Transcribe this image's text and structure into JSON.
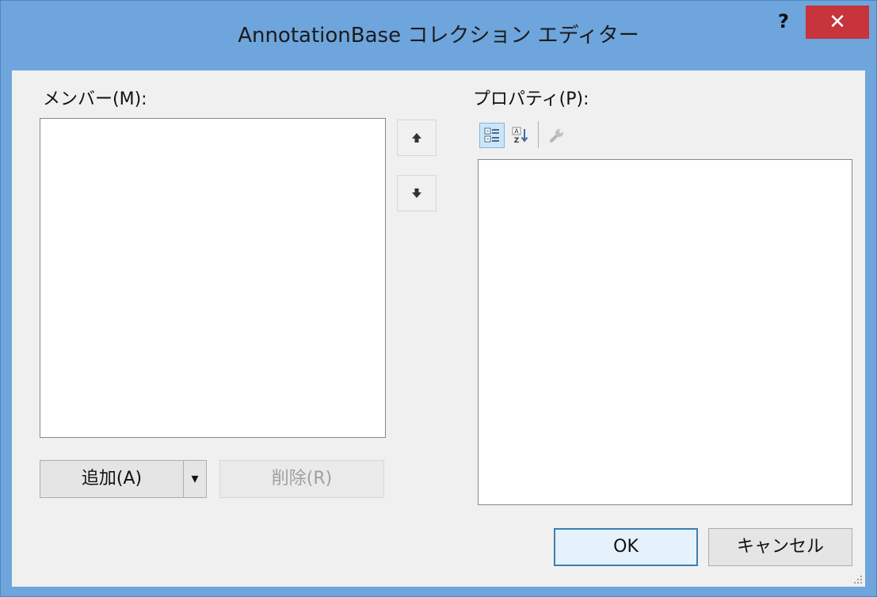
{
  "window": {
    "title": "AnnotationBase コレクション エディター",
    "help_label": "?",
    "close_label": "✕"
  },
  "members": {
    "label": "メンバー(M):",
    "items": [],
    "add_label": "追加(A)",
    "add_dropdown_label": "▾",
    "remove_label": "削除(R)"
  },
  "properties": {
    "label": "プロパティ(P):",
    "toolbar": [
      {
        "icon": "categorized-icon",
        "active": true
      },
      {
        "icon": "alphabetical-sort-icon",
        "active": false
      },
      {
        "icon": "property-pages-icon",
        "active": false,
        "disabled": true
      }
    ]
  },
  "footer": {
    "ok_label": "OK",
    "cancel_label": "キャンセル"
  },
  "colors": {
    "title_bar": "#6ea5dc",
    "close_button": "#c7343b",
    "client": "#f0f0f0"
  }
}
